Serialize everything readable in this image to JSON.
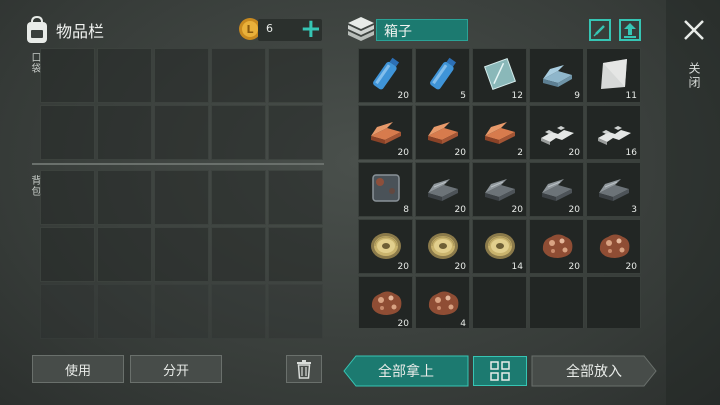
{
  "inventory": {
    "title": "物品栏",
    "coins": "6",
    "pocket_label": "口袋",
    "backpack_label": "背包",
    "use_label": "使用",
    "split_label": "分开"
  },
  "box": {
    "title": "箱子",
    "take_all_label": "全部拿上",
    "put_all_label": "全部放入",
    "items": [
      {
        "icon": "water-bottle-icon",
        "qty": "20"
      },
      {
        "icon": "water-bottle-icon",
        "qty": "5"
      },
      {
        "icon": "glass-pane-icon",
        "qty": "12"
      },
      {
        "icon": "steel-ingot-icon",
        "qty": "9"
      },
      {
        "icon": "metal-sheet-icon",
        "qty": "11"
      },
      {
        "icon": "copper-ingot-icon",
        "qty": "20"
      },
      {
        "icon": "copper-ingot-icon",
        "qty": "20"
      },
      {
        "icon": "copper-ingot-icon",
        "qty": "2"
      },
      {
        "icon": "aluminum-bar-icon",
        "qty": "20"
      },
      {
        "icon": "aluminum-bar-icon",
        "qty": "16"
      },
      {
        "icon": "metal-plate-icon",
        "qty": "8"
      },
      {
        "icon": "iron-ingot-icon",
        "qty": "20"
      },
      {
        "icon": "iron-ingot-icon",
        "qty": "20"
      },
      {
        "icon": "iron-ingot-icon",
        "qty": "20"
      },
      {
        "icon": "iron-ingot-icon",
        "qty": "3"
      },
      {
        "icon": "wire-spool-icon",
        "qty": "20"
      },
      {
        "icon": "wire-spool-icon",
        "qty": "20"
      },
      {
        "icon": "wire-spool-icon",
        "qty": "14"
      },
      {
        "icon": "copper-ore-icon",
        "qty": "20"
      },
      {
        "icon": "copper-ore-icon",
        "qty": "20"
      },
      {
        "icon": "copper-ore-icon",
        "qty": "20"
      },
      {
        "icon": "copper-ore-icon",
        "qty": "4"
      },
      {
        "icon": "",
        "qty": ""
      },
      {
        "icon": "",
        "qty": ""
      },
      {
        "icon": "",
        "qty": ""
      }
    ]
  },
  "close_label": "关闭",
  "colors": {
    "accent": "#36c5b4",
    "accent_dark": "#1c7a70"
  }
}
